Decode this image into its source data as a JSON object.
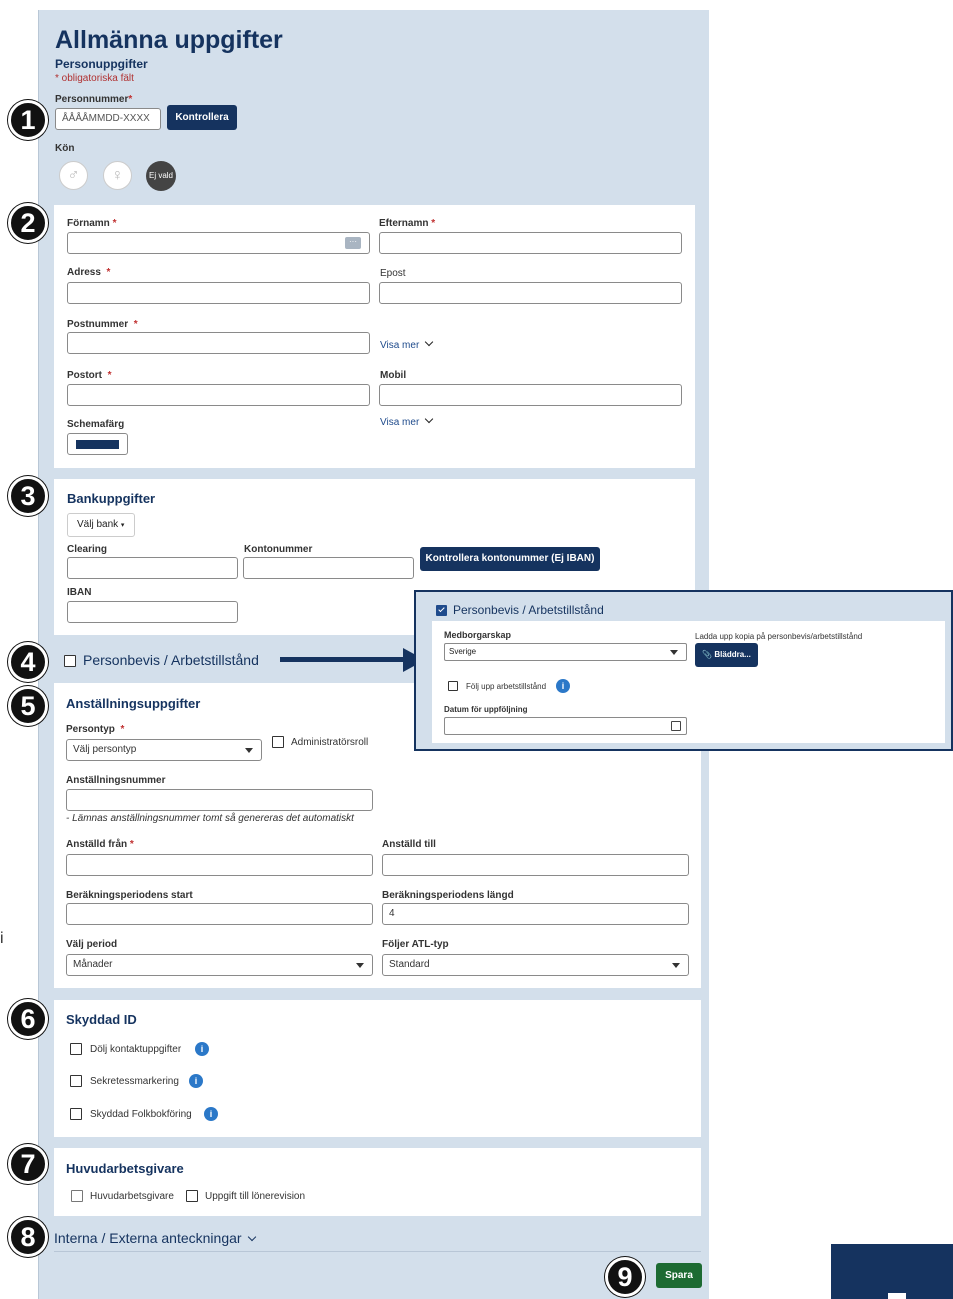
{
  "header": {
    "title": "Allmänna uppgifter",
    "subtitle": "Personuppgifter",
    "required_note": "* obligatoriska fält"
  },
  "personnummer": {
    "label": "Personnummer",
    "star": "*",
    "placeholder": "ÅÅÅÅMMDD-XXXX",
    "check_button": "Kontrollera"
  },
  "gender": {
    "label": "Kön",
    "male_icon": "♂",
    "female_icon": "♀",
    "none_label": "Ej vald"
  },
  "person": {
    "firstname_label": "Förnamn",
    "lastname_label": "Efternamn",
    "address_label": "Adress",
    "email_label": "Epost",
    "postal_code_label": "Postnummer",
    "show_more_1": "Visa mer",
    "city_label": "Postort",
    "mobile_label": "Mobil",
    "show_more_2": "Visa mer",
    "schedule_color_label": "Schemafärg",
    "schedule_color": "#15335f",
    "star": "*"
  },
  "bank": {
    "title": "Bankuppgifter",
    "select_bank": "Välj bank",
    "clearing_label": "Clearing",
    "account_label": "Kontonummer",
    "check_button": "Kontrollera kontonummer (Ej IBAN)",
    "iban_label": "IBAN"
  },
  "permit": {
    "toggle_label": "Personbevis / Arbetstillstånd",
    "popup_title": "Personbevis / Arbetstillstånd",
    "citizenship_label": "Medborgarskap",
    "citizenship_value": "Sverige",
    "upload_label": "Ladda upp kopia på personbevis/arbetstillstånd",
    "browse_button": "Bläddra...",
    "follow_up_label": "Följ upp arbetstillstånd",
    "follow_date_label": "Datum för uppföljning"
  },
  "employment": {
    "title": "Anställningsuppgifter",
    "person_type_label": "Persontyp",
    "person_type_value": "Välj persontyp",
    "admin_role_label": "Administratörsroll",
    "employee_number_label": "Anställningsnummer",
    "employee_number_hint": "- Lämnas anställningsnummer tomt så genereras det automatiskt",
    "employed_from_label": "Anställd från",
    "employed_to_label": "Anställd till",
    "period_start_label": "Beräkningsperiodens start",
    "period_length_label": "Beräkningsperiodens längd",
    "period_length_value": "4",
    "period_label": "Välj period",
    "period_value": "Månader",
    "atl_label": "Följer ATL-typ",
    "atl_value": "Standard",
    "star": "*"
  },
  "protected": {
    "title": "Skyddad ID",
    "option1": "Dölj kontaktuppgifter",
    "option2": "Sekretessmarkering",
    "option3": "Skyddad Folkbokföring"
  },
  "main_employer": {
    "title": "Huvudarbetsgivare",
    "option1": "Huvudarbetsgivare",
    "option2": "Uppgift till lönerevision"
  },
  "notes": {
    "label": "Interna / Externa anteckningar"
  },
  "footer": {
    "save": "Spara"
  },
  "badges": [
    "1",
    "2",
    "3",
    "4",
    "5",
    "6",
    "7",
    "8",
    "9"
  ],
  "side": {
    "left_edge_letter": "i"
  },
  "colors": {
    "brand": "#15335f",
    "panel": "#d3dfeb",
    "save": "#1d6b32",
    "info": "#2b78c8"
  }
}
